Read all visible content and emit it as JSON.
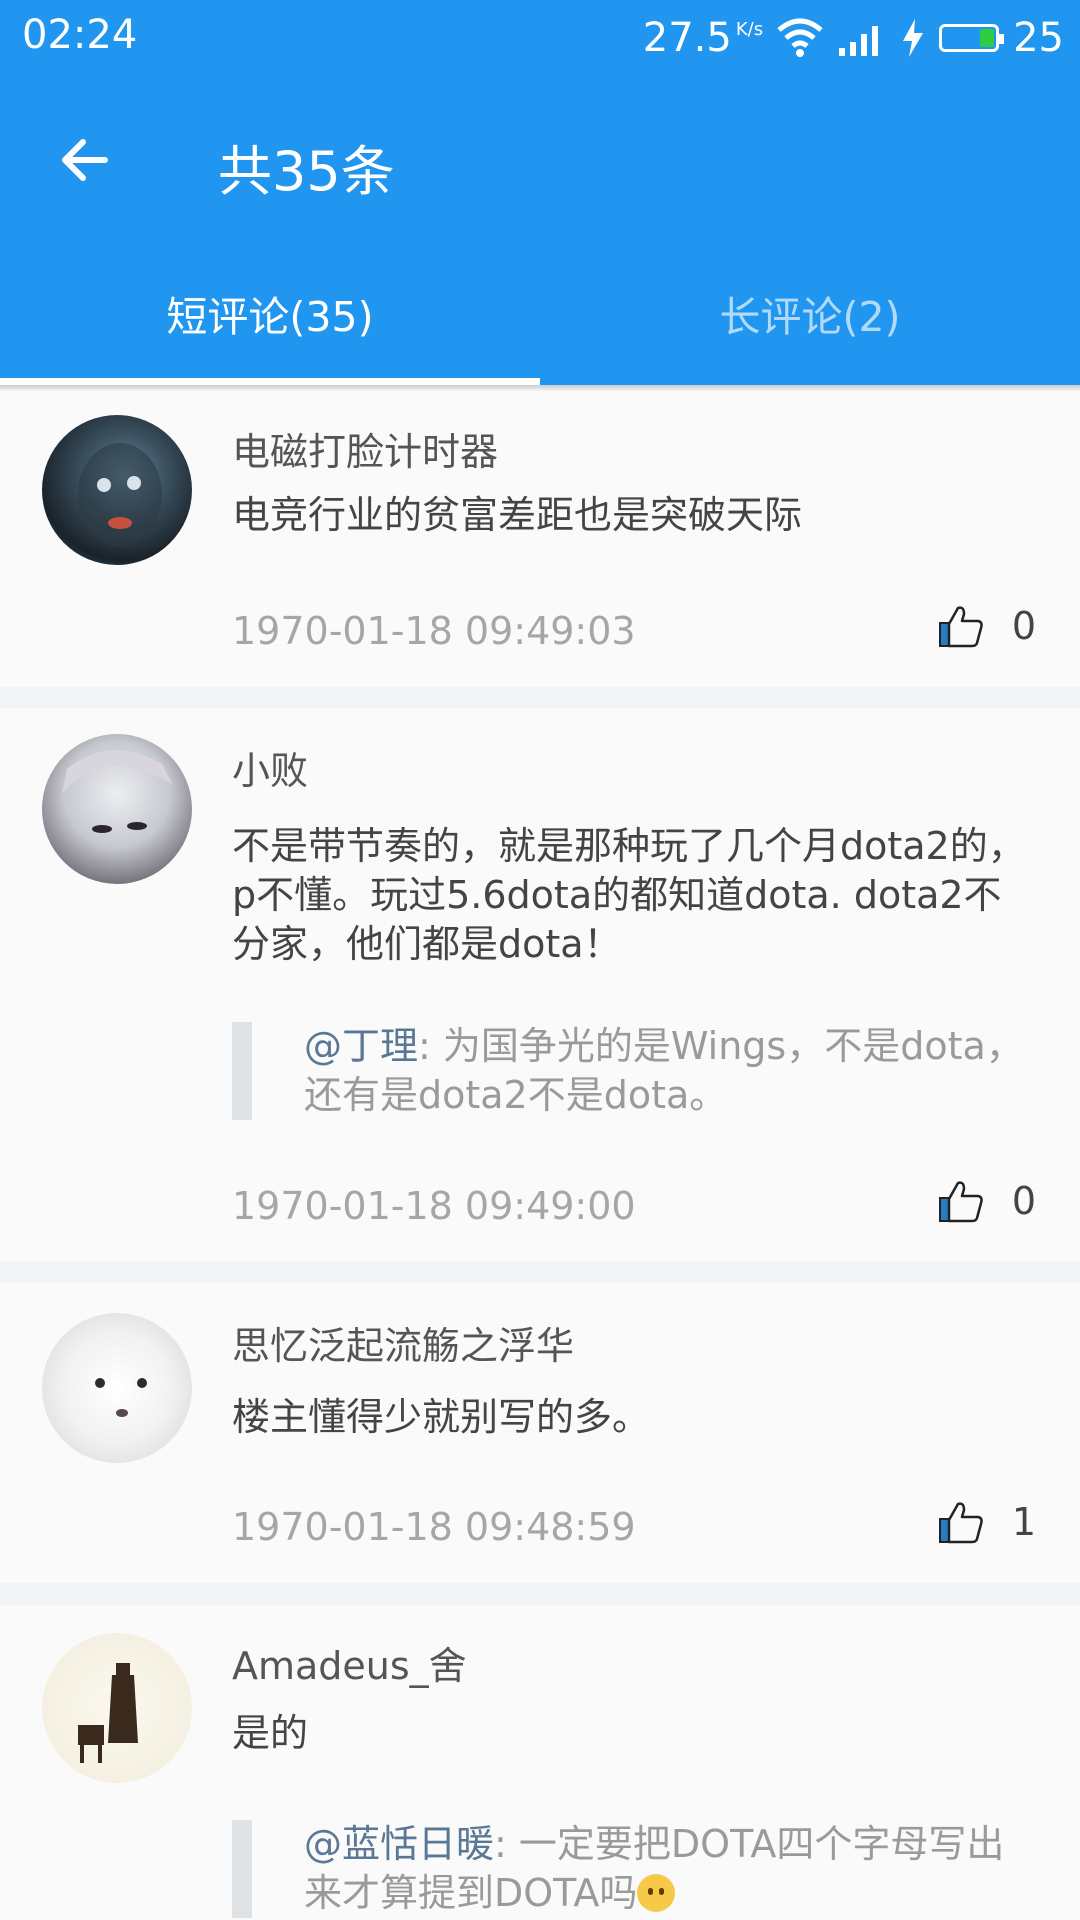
{
  "status_bar": {
    "time": "02:24",
    "speed": "27.5",
    "speed_unit": "K/s",
    "battery": "25",
    "icons": [
      "wifi-icon",
      "signal-icon",
      "charging-icon",
      "battery-icon"
    ]
  },
  "toolbar": {
    "title": "共35条",
    "back_icon": "arrow-left-icon"
  },
  "tabs": [
    {
      "label": "短评论(35)",
      "active": true
    },
    {
      "label": "长评论(2)",
      "active": false
    }
  ],
  "comments": [
    {
      "author": "电磁打脸计时器",
      "text": "电竞行业的贫富差距也是突破天际",
      "time": "1970-01-18 09:49:03",
      "likes": "0"
    },
    {
      "author": "小败",
      "text": "不是带节奏的，就是那种玩了几个月dota2的，p不懂。玩过5.6dota的都知道dota. dota2不分家，他们都是dota！",
      "reply_user": "@丁理",
      "reply_text": ": 为国争光的是Wings，不是dota，还有是dota2不是dota。",
      "time": "1970-01-18 09:49:00",
      "likes": "0"
    },
    {
      "author": "思忆泛起流觞之浮华",
      "text": "楼主懂得少就别写的多。",
      "time": "1970-01-18 09:48:59",
      "likes": "1"
    },
    {
      "author": "Amadeus_舍",
      "text": "是的",
      "reply_user": "@蓝恬日暖",
      "reply_text": ": 一定要把DOTA四个字母写出来才算提到DOTA吗"
    }
  ],
  "colors": {
    "primary": "#2196f0",
    "reply_user": "#5a7896"
  }
}
